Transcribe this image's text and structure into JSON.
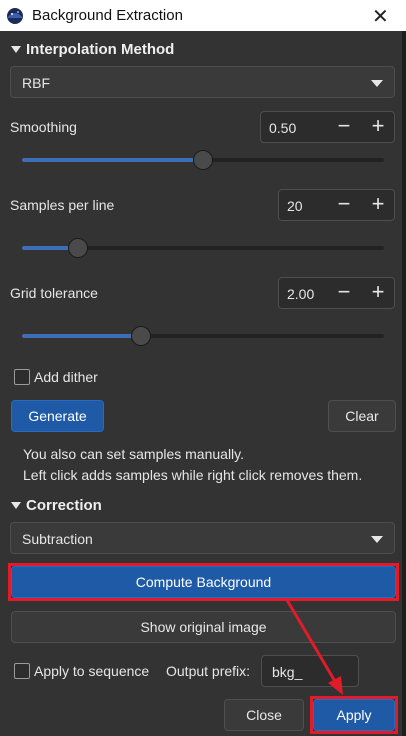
{
  "window": {
    "title": "Background Extraction"
  },
  "interpolation": {
    "header": "Interpolation Method",
    "method": "RBF",
    "smoothing": {
      "label": "Smoothing",
      "value": "0.50",
      "fraction": 0.5
    },
    "samples": {
      "label": "Samples per line",
      "value": "20",
      "fraction": 0.155
    },
    "grid": {
      "label": "Grid tolerance",
      "value": "2.00",
      "fraction": 0.33
    },
    "dither_label": "Add dither",
    "generate_label": "Generate",
    "clear_label": "Clear",
    "info_line1": "You also can set samples manually.",
    "info_line2": "Left click adds samples while right click removes them."
  },
  "correction": {
    "header": "Correction",
    "method": "Subtraction",
    "compute_label": "Compute Background",
    "show_original_label": "Show original image",
    "apply_seq_label": "Apply to sequence",
    "prefix_label": "Output prefix:",
    "prefix_value": "bkg_"
  },
  "footer": {
    "close_label": "Close",
    "apply_label": "Apply"
  },
  "icons": {
    "minus": "−",
    "plus": "+",
    "close": "✕"
  },
  "colors": {
    "accent": "#1e5aa6",
    "highlight": "#e11b2a"
  }
}
